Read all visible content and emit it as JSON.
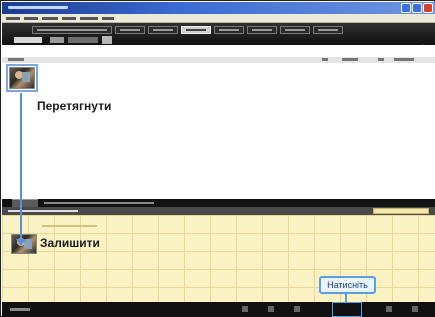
{
  "callouts": {
    "drag_label": "Перетягнути",
    "drop_label": "Залишити",
    "click_label": "Натисніть"
  },
  "icons": {
    "settings": "gear-icon",
    "thumbnail": "video-thumbnail-icon",
    "arrow": "arrow-down-icon"
  },
  "colors": {
    "title_bar": "#1a3d8f",
    "toolbar": "#1a1a1a",
    "lower_panel": "#fbf2c4",
    "arrow": "#5b8fd8",
    "callout_border": "#5b9ee6"
  }
}
